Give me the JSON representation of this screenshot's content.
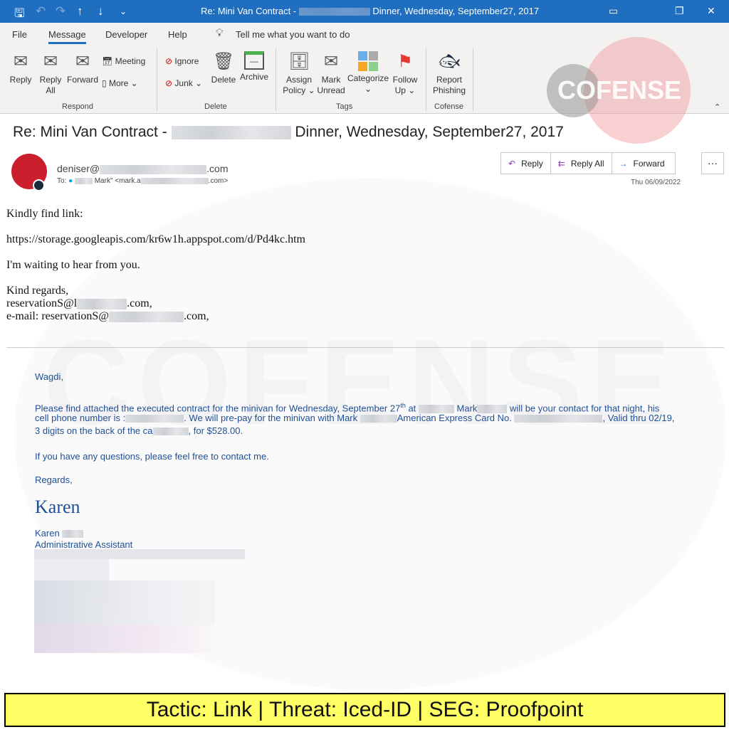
{
  "window": {
    "title_prefix": "Re: Mini Van Contract - ",
    "title_suffix": " Dinner, Wednesday, September27, 2017"
  },
  "quick_access": {
    "save": "save-icon",
    "undo": "undo-icon",
    "redo": "redo-icon",
    "up": "↑",
    "down": "↓",
    "customize": "⌄"
  },
  "window_controls": {
    "restore_ribbon": "▭",
    "restore": "❐",
    "close": "✕"
  },
  "menu_tabs": [
    "File",
    "Message",
    "Developer",
    "Help"
  ],
  "active_tab": "Message",
  "tell_me": "Tell me what you want to do",
  "ribbon": {
    "respond": {
      "label": "Respond",
      "reply": "Reply",
      "reply_all_1": "Reply",
      "reply_all_2": "All",
      "forward": "Forward",
      "meeting": "Meeting",
      "more": "More"
    },
    "delete": {
      "label": "Delete",
      "ignore": "Ignore",
      "junk": "Junk",
      "delete": "Delete",
      "archive": "Archive"
    },
    "tags": {
      "label": "Tags",
      "assign_1": "Assign",
      "assign_2": "Policy",
      "mark_1": "Mark",
      "mark_2": "Unread",
      "categorize": "Categorize",
      "follow_1": "Follow",
      "follow_2": "Up"
    },
    "cofense": {
      "label": "Cofense",
      "report_1": "Report",
      "report_2": "Phishing"
    }
  },
  "logo_text": "COFENSE",
  "message": {
    "subject_prefix": "Re: Mini Van Contract - ",
    "subject_suffix": " Dinner, Wednesday, September27, 2017",
    "from_prefix": "deniser@",
    "from_suffix": ".com",
    "to_label": "To:",
    "to_mid": " Mark\" <mark.a",
    "to_suffix": ".com>",
    "date": "Thu 06/09/2022",
    "actions": {
      "reply": "Reply",
      "reply_all": "Reply All",
      "forward": "Forward",
      "more": "···"
    }
  },
  "body": {
    "line1": "Kindly find link:",
    "link": "https://storage.googleapis.com/kr6w1h.appspot.com/d/Pd4kc.htm",
    "line3": "I'm waiting to hear from you.",
    "regards": "Kind regards,",
    "sig1_prefix": "reservationS@l",
    "sig1_suffix": ".com,",
    "sig2_prefix": "e-mail: reservationS@",
    "sig2_suffix": ".com,"
  },
  "quoted": {
    "greeting": "Wagdi,",
    "p1a": "Please find attached the executed contract for the minivan for Wednesday, September 27",
    "p1sup": "th",
    "p1b": " at ",
    "p1c": "  Mark",
    "p1d": " will be your contact for that night, his",
    "p2a": "cell phone number is :",
    "p2b": ".  We will pre-pay for the minivan with Mark ",
    "p2c": "American Express Card No. ",
    "p2d": ", Valid thru 02/19,",
    "p3a": "3 digits on the back of the ca",
    "p3b": ", for $528.00.",
    "p4": "If you have any questions, please feel free to contact me.",
    "regards": "Regards,",
    "signature": "Karen",
    "name": "Karen",
    "role": "Administrative Assistant"
  },
  "banner": "Tactic: Link | Threat: Iced-ID | SEG: Proofpoint",
  "colors": {
    "titlebar": "#1f6ec0",
    "avatar": "#cc1f2e",
    "quoted_text": "#1f4f96",
    "banner": "#ffff66"
  }
}
